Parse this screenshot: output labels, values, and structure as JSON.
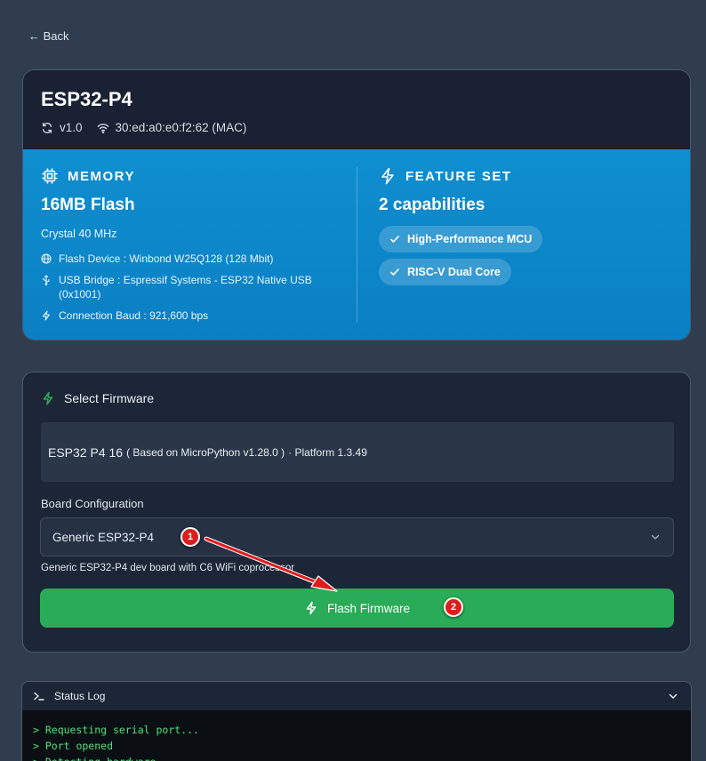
{
  "nav": {
    "back_label": "← Back"
  },
  "device": {
    "name": "ESP32-P4",
    "version": "v1.0",
    "mac": "30:ed:a0:e0:f2:62 (MAC)",
    "memory": {
      "title": "MEMORY",
      "flash": "16MB Flash",
      "crystal": "Crystal 40 MHz",
      "specs": [
        "Flash Device : Winbond W25Q128 (128 Mbit)",
        "USB Bridge : Espressif Systems - ESP32 Native USB (0x1001)",
        "Connection Baud : 921,600 bps"
      ]
    },
    "features": {
      "title": "FEATURE SET",
      "count": "2 capabilities",
      "items": [
        "High-Performance MCU",
        "RISC-V Dual Core"
      ]
    }
  },
  "firmware": {
    "section_title": "Select Firmware",
    "selected_name": "ESP32 P4 16",
    "selected_based": "( Based on MicroPython v1.28.0 )",
    "selected_platform": "· Platform 1.3.49",
    "board_label": "Board Configuration",
    "board_value": "Generic ESP32-P4",
    "board_desc": "Generic ESP32-P4 dev board with C6 WiFi coprocessor",
    "flash_label": "Flash Firmware"
  },
  "annotations": {
    "badge_1": "1",
    "badge_2": "2"
  },
  "status_log": {
    "title": "Status Log",
    "lines": [
      "> Requesting serial port...",
      "> Port opened",
      "> Detecting hardware..."
    ]
  },
  "colors": {
    "accent_green": "#2aab57",
    "accent_blue": "#0f8fd0",
    "annotation_red": "#d91e1e"
  }
}
